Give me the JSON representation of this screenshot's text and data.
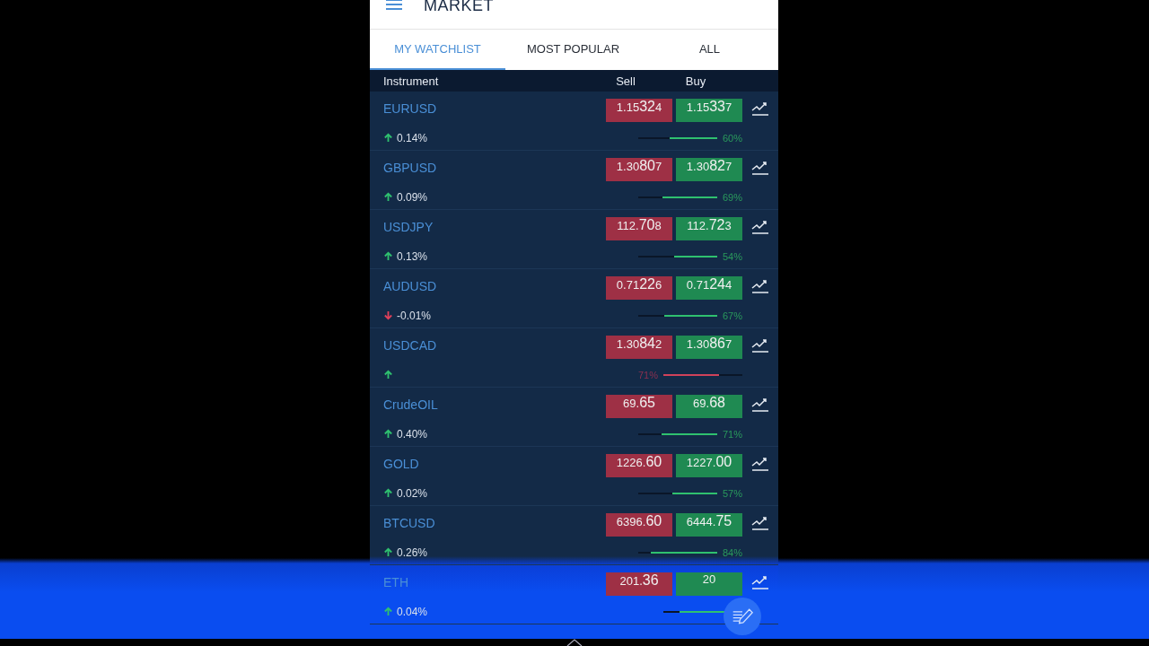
{
  "header": {
    "title": "MARKET"
  },
  "tabs": [
    {
      "label": "MY WATCHLIST",
      "selected": true
    },
    {
      "label": "MOST POPULAR",
      "selected": false
    },
    {
      "label": "ALL",
      "selected": false
    }
  ],
  "columns": {
    "instrument": "Instrument",
    "sell": "Sell",
    "buy": "Buy"
  },
  "rows": [
    {
      "name": "EURUSD",
      "falling": false,
      "change": "0.14%",
      "sell": {
        "pre": "1.15",
        "big": "32",
        "post": "4"
      },
      "buy": {
        "pre": "1.15",
        "big": "33",
        "post": "7"
      },
      "sellers_lead": false,
      "level": 0.6,
      "percent": "60%"
    },
    {
      "name": "GBPUSD",
      "falling": false,
      "change": "0.09%",
      "sell": {
        "pre": "1.30",
        "big": "80",
        "post": "7"
      },
      "buy": {
        "pre": "1.30",
        "big": "82",
        "post": "7"
      },
      "sellers_lead": false,
      "level": 0.69,
      "percent": "69%"
    },
    {
      "name": "USDJPY",
      "falling": false,
      "change": "0.13%",
      "sell": {
        "pre": "112.",
        "big": "70",
        "post": "8"
      },
      "buy": {
        "pre": "112.",
        "big": "72",
        "post": "3"
      },
      "sellers_lead": false,
      "level": 0.54,
      "percent": "54%"
    },
    {
      "name": "AUDUSD",
      "falling": true,
      "change": "-0.01%",
      "sell": {
        "pre": "0.71",
        "big": "22",
        "post": "6"
      },
      "buy": {
        "pre": "0.71",
        "big": "24",
        "post": "4"
      },
      "sellers_lead": false,
      "level": 0.67,
      "percent": "67%"
    },
    {
      "name": "USDCAD",
      "falling": false,
      "sell": {
        "pre": "1.30",
        "big": "84",
        "post": "2"
      },
      "buy": {
        "pre": "1.30",
        "big": "86",
        "post": "7"
      },
      "sellers_lead": true,
      "level": 0.71,
      "percent": "71%"
    },
    {
      "name": "CrudeOIL",
      "falling": false,
      "change": "0.40%",
      "sell": {
        "pre": "69.",
        "big": "65"
      },
      "buy": {
        "pre": "69.",
        "big": "68"
      },
      "sellers_lead": false,
      "level": 0.71,
      "percent": "71%"
    },
    {
      "name": "GOLD",
      "falling": false,
      "change": "0.02%",
      "sell": {
        "pre": "1226.",
        "big": "60"
      },
      "buy": {
        "pre": "1227.",
        "big": "00"
      },
      "sellers_lead": false,
      "level": 0.57,
      "percent": "57%"
    },
    {
      "name": "BTCUSD",
      "falling": false,
      "change": "0.26%",
      "sell": {
        "pre": "6396.",
        "big": "60"
      },
      "buy": {
        "pre": "6444.",
        "big": "75"
      },
      "sellers_lead": false,
      "level": 0.84,
      "percent": "84%"
    },
    {
      "name": "ETH",
      "falling": false,
      "change": "0.04%",
      "sell": {
        "pre": "201.",
        "big": "36"
      },
      "buy": {
        "pre": "20"
      },
      "sellers_lead": false,
      "level": 0.8
    }
  ]
}
